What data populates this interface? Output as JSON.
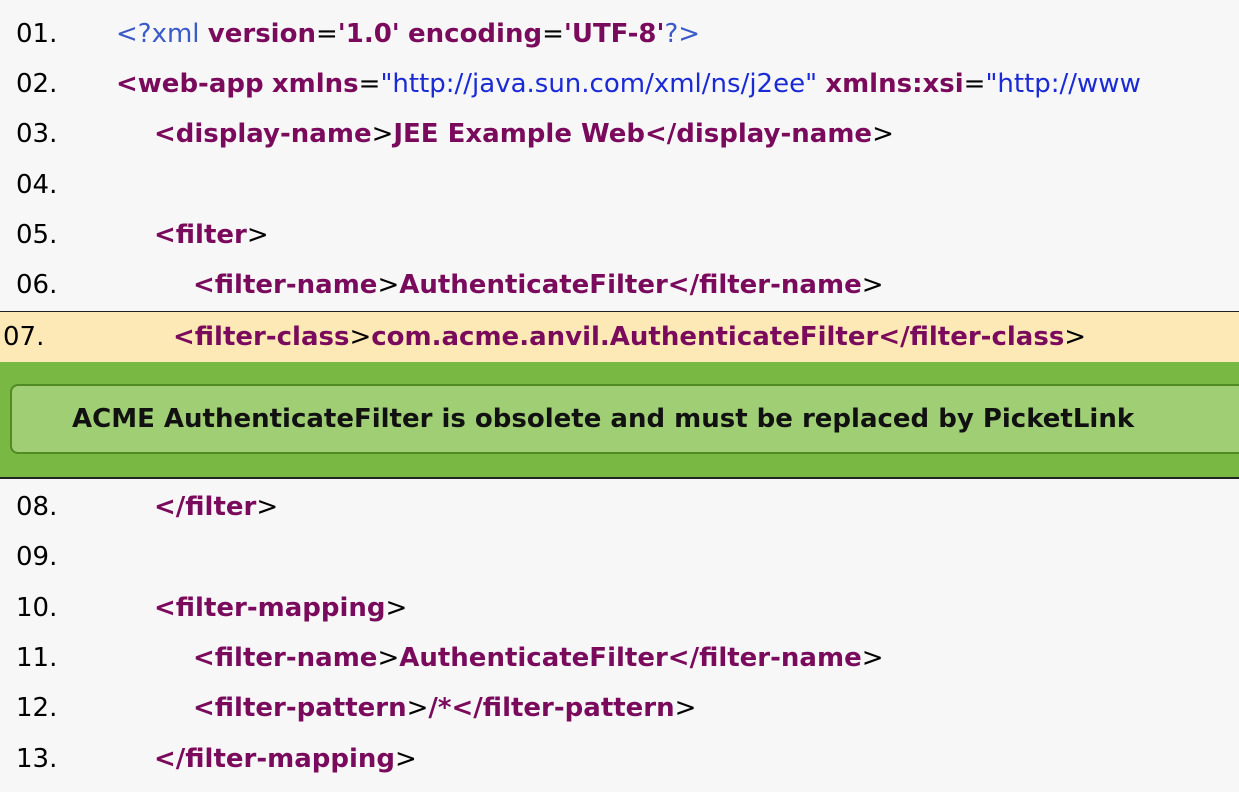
{
  "lines": [
    {
      "num": "01.",
      "pi_open": "<?xml",
      "attr1": "version",
      "eq": "=",
      "val1": "'1.0'",
      "attr2": "encoding",
      "val2": "'UTF-8'",
      "pi_close": "?>"
    },
    {
      "num": "02.",
      "tag_open": "<web-app",
      "attr1": "xmlns",
      "eq": "=",
      "url1": "\"http://java.sun.com/xml/ns/j2ee\"",
      "attr2": "xmlns:xsi",
      "url2": "\"http://www"
    },
    {
      "num": "03.",
      "open": "<display-name",
      "gt": ">",
      "text": "JEE Example Web",
      "close": "</display-name",
      "gt2": ">"
    },
    {
      "num": "04."
    },
    {
      "num": "05.",
      "open": "<filter",
      "gt": ">"
    },
    {
      "num": "06.",
      "open": "<filter-name",
      "gt": ">",
      "text": "AuthenticateFilter",
      "close": "</filter-name",
      "gt2": ">"
    },
    {
      "num": "07.",
      "open": "<filter-class",
      "gt": ">",
      "text": "com.acme.anvil.AuthenticateFilter",
      "close": "</filter-class",
      "gt2": ">"
    },
    {
      "num": "08.",
      "open": "</filter",
      "gt": ">"
    },
    {
      "num": "09."
    },
    {
      "num": "10.",
      "open": "<filter-mapping",
      "gt": ">"
    },
    {
      "num": "11.",
      "open": "<filter-name",
      "gt": ">",
      "text": "AuthenticateFilter",
      "close": "</filter-name",
      "gt2": ">"
    },
    {
      "num": "12.",
      "open": "<filter-pattern",
      "gt": ">",
      "text": "/*",
      "close": "</filter-pattern",
      "gt2": ">"
    },
    {
      "num": "13.",
      "open": "</filter-mapping",
      "gt": ">"
    }
  ],
  "annotation": {
    "message": "ACME AuthenticateFilter is obsolete and must be replaced by PicketLink"
  },
  "colors": {
    "tag": "#7a0a5c",
    "url": "#1a2bd6",
    "highlight_line": "#fde9b5",
    "annotation_band": "#79b843",
    "annotation_box": "#9fce74"
  }
}
